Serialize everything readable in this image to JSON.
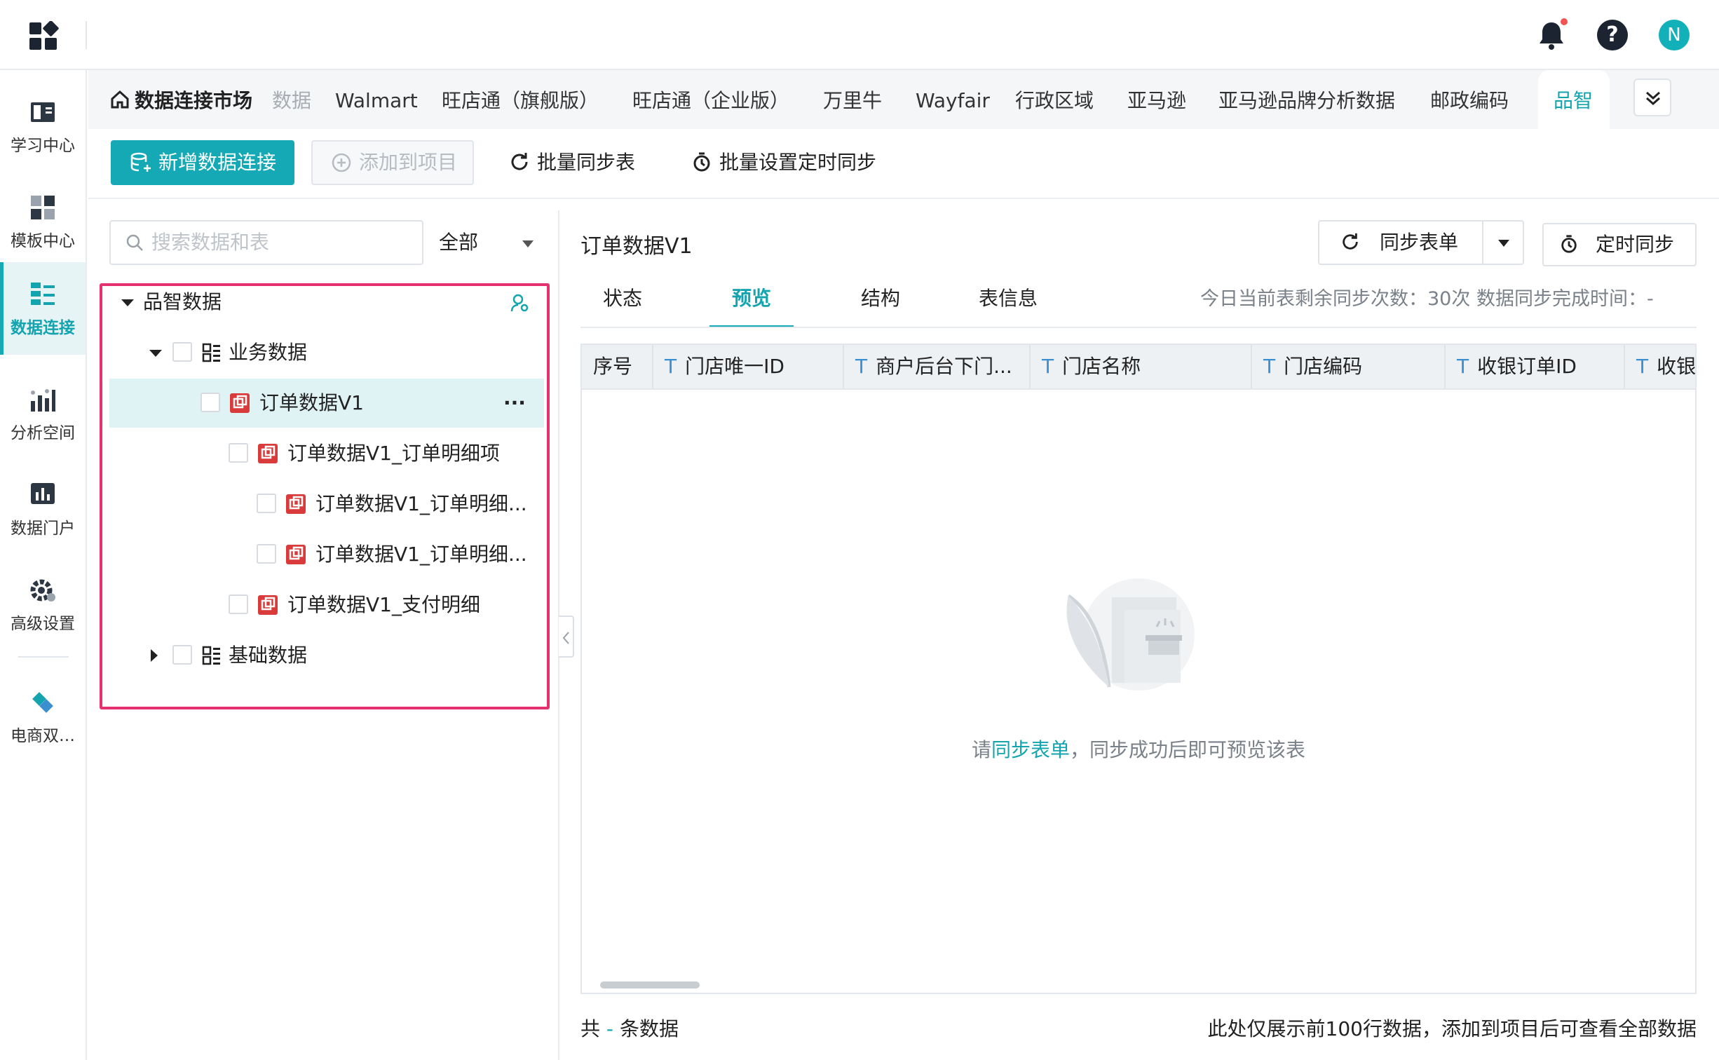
{
  "nav": {
    "items": [
      {
        "label": "学习中心",
        "icon": "book-icon"
      },
      {
        "label": "模板中心",
        "icon": "template-icon"
      },
      {
        "label": "数据连接",
        "icon": "data-connection-icon"
      },
      {
        "label": "分析空间",
        "icon": "analysis-icon"
      },
      {
        "label": "数据门户",
        "icon": "bar-chart-icon"
      },
      {
        "label": "高级设置",
        "icon": "gear-icon"
      },
      {
        "label": "电商双…",
        "icon": "diamond-icon"
      }
    ],
    "active_index": 2
  },
  "header": {
    "avatar_initial": "N",
    "help_symbol": "?"
  },
  "tabs": {
    "home_label": "数据连接市场",
    "items": [
      "数据",
      "Walmart",
      "旺店通（旗舰版）",
      "旺店通（企业版）",
      "万里牛",
      "Wayfair",
      "行政区域",
      "亚马逊",
      "亚马逊品牌分析数据",
      "邮政编码",
      "品智"
    ],
    "active": "品智"
  },
  "toolbar": {
    "add_connection": "新增数据连接",
    "add_to_project": "添加到项目",
    "batch_sync": "批量同步表",
    "batch_schedule": "批量设置定时同步"
  },
  "search": {
    "placeholder": "搜索数据和表",
    "filter": "全部"
  },
  "tree": {
    "root": "品智数据",
    "group1": "业务数据",
    "selected": "订单数据V1",
    "children": [
      "订单数据V1_订单明细项",
      "订单数据V1_订单明细...",
      "订单数据V1_订单明细...",
      "订单数据V1_支付明细"
    ],
    "group2": "基础数据",
    "more": "···"
  },
  "detail": {
    "title": "订单数据V1",
    "sync_button": "同步表单",
    "schedule_button": "定时同步",
    "subtabs": [
      "状态",
      "预览",
      "结构",
      "表信息"
    ],
    "active_subtab": "预览",
    "sync_info": "今日当前表剩余同步次数：30次   数据同步完成时间：-",
    "columns": [
      "序号",
      "门店唯一ID",
      "商户后台下门...",
      "门店名称",
      "门店编码",
      "收银订单ID",
      "收银"
    ],
    "type_marker": "T",
    "empty_prefix": "请",
    "empty_link": "同步表单",
    "empty_suffix": "，同步成功后即可预览该表",
    "footer_prefix": "共",
    "footer_count": "-",
    "footer_suffix": "条数据",
    "footer_note": "此处仅展示前100行数据，添加到项目后可查看全部数据"
  },
  "colors": {
    "accent": "#14a9b5",
    "highlight": "#e5316f",
    "table_icon": "#d93b3b"
  }
}
